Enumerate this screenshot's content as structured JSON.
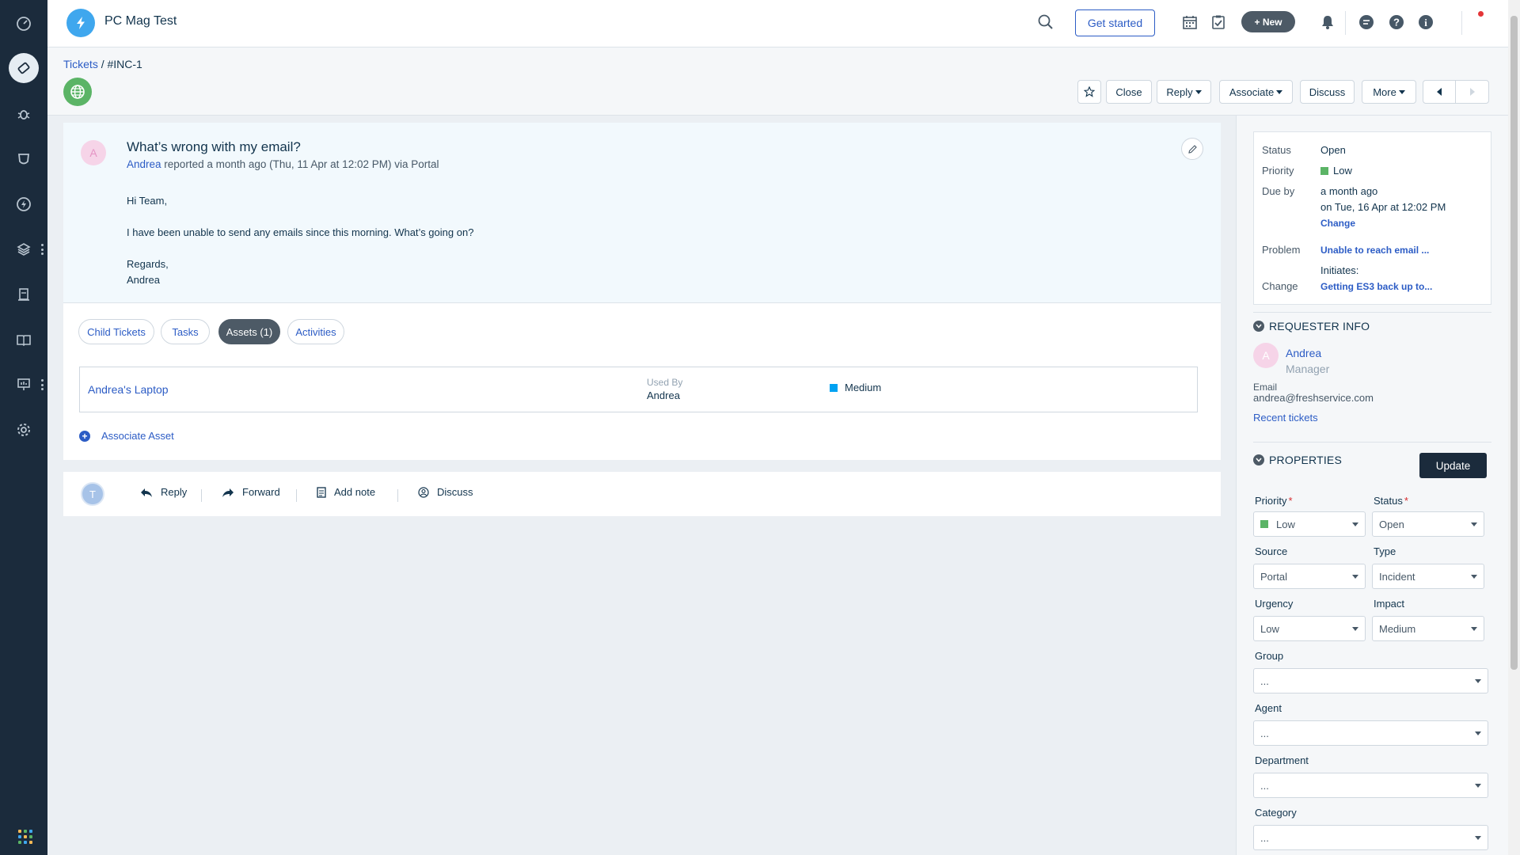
{
  "header": {
    "workspace_title": "PC Mag Test",
    "get_started_label": "Get started",
    "new_label": "+ New",
    "user_initial": "T"
  },
  "breadcrumb": {
    "link": "Tickets",
    "separator": " / ",
    "current": "#INC-1"
  },
  "actions": {
    "close": "Close",
    "reply": "Reply",
    "associate": "Associate",
    "discuss": "Discuss",
    "more": "More"
  },
  "ticket": {
    "requester_initial": "A",
    "subject": "What’s wrong with my email?",
    "requester_name": "Andrea",
    "meta_text": " reported a month ago (Thu, 11 Apr at 12:02 PM) via Portal",
    "body": {
      "greeting": "Hi Team,",
      "message": "I have been unable to send any emails since this morning. What’s going on?",
      "closing": "Regards,",
      "signature": "Andrea"
    }
  },
  "tabs": [
    {
      "label": "Child Tickets"
    },
    {
      "label": "Tasks"
    },
    {
      "label": "Assets (1)"
    },
    {
      "label": "Activities"
    }
  ],
  "asset": {
    "name": "Andrea's Laptop",
    "used_by_label": "Used By",
    "used_by": "Andrea",
    "impact": "Medium",
    "impact_color": "#00a2f2"
  },
  "associate_asset_label": "Associate Asset",
  "reply_bar": {
    "avatar_initial": "T",
    "reply": "Reply",
    "forward": "Forward",
    "add_note": "Add note",
    "discuss": "Discuss"
  },
  "sla": {
    "status_label": "Status",
    "status_value": "Open",
    "priority_label": "Priority",
    "priority_value": "Low",
    "priority_color": "#5bb466",
    "due_label": "Due by",
    "due_relative": "a month ago",
    "due_absolute": "on Tue, 16 Apr at 12:02 PM",
    "change_link": "Change",
    "problem_label": "Problem",
    "problem_link": "Unable to reach email ...",
    "initiates_label": "Initiates:",
    "change_label": "Change",
    "change_record_link": "Getting ES3 back up to..."
  },
  "requester_info": {
    "heading": "REQUESTER INFO",
    "initial": "A",
    "name": "Andrea",
    "role": "Manager",
    "email_label": "Email",
    "email": "andrea@freshservice.com",
    "recent_tickets": "Recent tickets"
  },
  "properties": {
    "heading": "PROPERTIES",
    "update_label": "Update",
    "required_mark": "*",
    "priority_label": "Priority",
    "priority_value": "Low",
    "status_label": "Status",
    "status_value": "Open",
    "source_label": "Source",
    "source_value": "Portal",
    "type_label": "Type",
    "type_value": "Incident",
    "urgency_label": "Urgency",
    "urgency_value": "Low",
    "impact_label": "Impact",
    "impact_value": "Medium",
    "group_label": "Group",
    "group_value": "...",
    "agent_label": "Agent",
    "agent_value": "...",
    "department_label": "Department",
    "department_value": "...",
    "category_label": "Category",
    "category_value": "..."
  },
  "colors": {
    "rail_bg": "#1b2b3c",
    "link_blue": "#2c5cc5",
    "low_green": "#5bb466",
    "medium_blue": "#00a2f2",
    "logo_blue": "#3fa7ee"
  }
}
